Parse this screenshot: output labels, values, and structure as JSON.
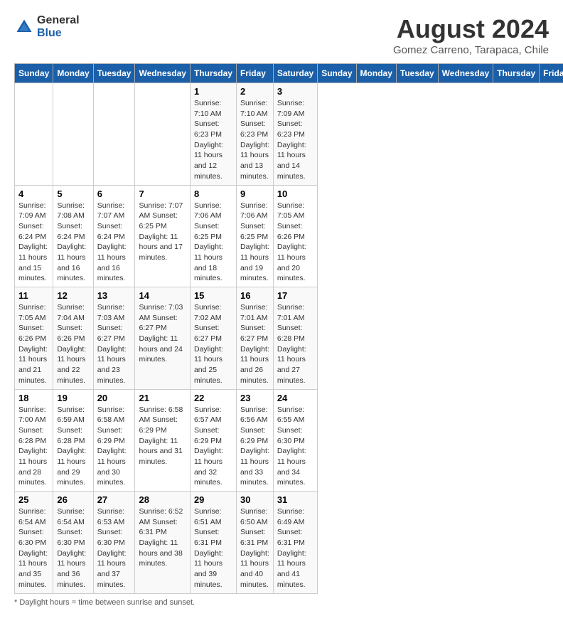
{
  "header": {
    "logo_general": "General",
    "logo_blue": "Blue",
    "month_title": "August 2024",
    "subtitle": "Gomez Carreno, Tarapaca, Chile"
  },
  "days_of_week": [
    "Sunday",
    "Monday",
    "Tuesday",
    "Wednesday",
    "Thursday",
    "Friday",
    "Saturday"
  ],
  "footer": {
    "note": "Daylight hours"
  },
  "weeks": [
    [
      {
        "day": "",
        "info": ""
      },
      {
        "day": "",
        "info": ""
      },
      {
        "day": "",
        "info": ""
      },
      {
        "day": "",
        "info": ""
      },
      {
        "day": "1",
        "info": "Sunrise: 7:10 AM\nSunset: 6:23 PM\nDaylight: 11 hours\nand 12 minutes."
      },
      {
        "day": "2",
        "info": "Sunrise: 7:10 AM\nSunset: 6:23 PM\nDaylight: 11 hours\nand 13 minutes."
      },
      {
        "day": "3",
        "info": "Sunrise: 7:09 AM\nSunset: 6:23 PM\nDaylight: 11 hours\nand 14 minutes."
      }
    ],
    [
      {
        "day": "4",
        "info": "Sunrise: 7:09 AM\nSunset: 6:24 PM\nDaylight: 11 hours\nand 15 minutes."
      },
      {
        "day": "5",
        "info": "Sunrise: 7:08 AM\nSunset: 6:24 PM\nDaylight: 11 hours\nand 16 minutes."
      },
      {
        "day": "6",
        "info": "Sunrise: 7:07 AM\nSunset: 6:24 PM\nDaylight: 11 hours\nand 16 minutes."
      },
      {
        "day": "7",
        "info": "Sunrise: 7:07 AM\nSunset: 6:25 PM\nDaylight: 11 hours\nand 17 minutes."
      },
      {
        "day": "8",
        "info": "Sunrise: 7:06 AM\nSunset: 6:25 PM\nDaylight: 11 hours\nand 18 minutes."
      },
      {
        "day": "9",
        "info": "Sunrise: 7:06 AM\nSunset: 6:25 PM\nDaylight: 11 hours\nand 19 minutes."
      },
      {
        "day": "10",
        "info": "Sunrise: 7:05 AM\nSunset: 6:26 PM\nDaylight: 11 hours\nand 20 minutes."
      }
    ],
    [
      {
        "day": "11",
        "info": "Sunrise: 7:05 AM\nSunset: 6:26 PM\nDaylight: 11 hours\nand 21 minutes."
      },
      {
        "day": "12",
        "info": "Sunrise: 7:04 AM\nSunset: 6:26 PM\nDaylight: 11 hours\nand 22 minutes."
      },
      {
        "day": "13",
        "info": "Sunrise: 7:03 AM\nSunset: 6:27 PM\nDaylight: 11 hours\nand 23 minutes."
      },
      {
        "day": "14",
        "info": "Sunrise: 7:03 AM\nSunset: 6:27 PM\nDaylight: 11 hours\nand 24 minutes."
      },
      {
        "day": "15",
        "info": "Sunrise: 7:02 AM\nSunset: 6:27 PM\nDaylight: 11 hours\nand 25 minutes."
      },
      {
        "day": "16",
        "info": "Sunrise: 7:01 AM\nSunset: 6:27 PM\nDaylight: 11 hours\nand 26 minutes."
      },
      {
        "day": "17",
        "info": "Sunrise: 7:01 AM\nSunset: 6:28 PM\nDaylight: 11 hours\nand 27 minutes."
      }
    ],
    [
      {
        "day": "18",
        "info": "Sunrise: 7:00 AM\nSunset: 6:28 PM\nDaylight: 11 hours\nand 28 minutes."
      },
      {
        "day": "19",
        "info": "Sunrise: 6:59 AM\nSunset: 6:28 PM\nDaylight: 11 hours\nand 29 minutes."
      },
      {
        "day": "20",
        "info": "Sunrise: 6:58 AM\nSunset: 6:29 PM\nDaylight: 11 hours\nand 30 minutes."
      },
      {
        "day": "21",
        "info": "Sunrise: 6:58 AM\nSunset: 6:29 PM\nDaylight: 11 hours\nand 31 minutes."
      },
      {
        "day": "22",
        "info": "Sunrise: 6:57 AM\nSunset: 6:29 PM\nDaylight: 11 hours\nand 32 minutes."
      },
      {
        "day": "23",
        "info": "Sunrise: 6:56 AM\nSunset: 6:29 PM\nDaylight: 11 hours\nand 33 minutes."
      },
      {
        "day": "24",
        "info": "Sunrise: 6:55 AM\nSunset: 6:30 PM\nDaylight: 11 hours\nand 34 minutes."
      }
    ],
    [
      {
        "day": "25",
        "info": "Sunrise: 6:54 AM\nSunset: 6:30 PM\nDaylight: 11 hours\nand 35 minutes."
      },
      {
        "day": "26",
        "info": "Sunrise: 6:54 AM\nSunset: 6:30 PM\nDaylight: 11 hours\nand 36 minutes."
      },
      {
        "day": "27",
        "info": "Sunrise: 6:53 AM\nSunset: 6:30 PM\nDaylight: 11 hours\nand 37 minutes."
      },
      {
        "day": "28",
        "info": "Sunrise: 6:52 AM\nSunset: 6:31 PM\nDaylight: 11 hours\nand 38 minutes."
      },
      {
        "day": "29",
        "info": "Sunrise: 6:51 AM\nSunset: 6:31 PM\nDaylight: 11 hours\nand 39 minutes."
      },
      {
        "day": "30",
        "info": "Sunrise: 6:50 AM\nSunset: 6:31 PM\nDaylight: 11 hours\nand 40 minutes."
      },
      {
        "day": "31",
        "info": "Sunrise: 6:49 AM\nSunset: 6:31 PM\nDaylight: 11 hours\nand 41 minutes."
      }
    ]
  ]
}
